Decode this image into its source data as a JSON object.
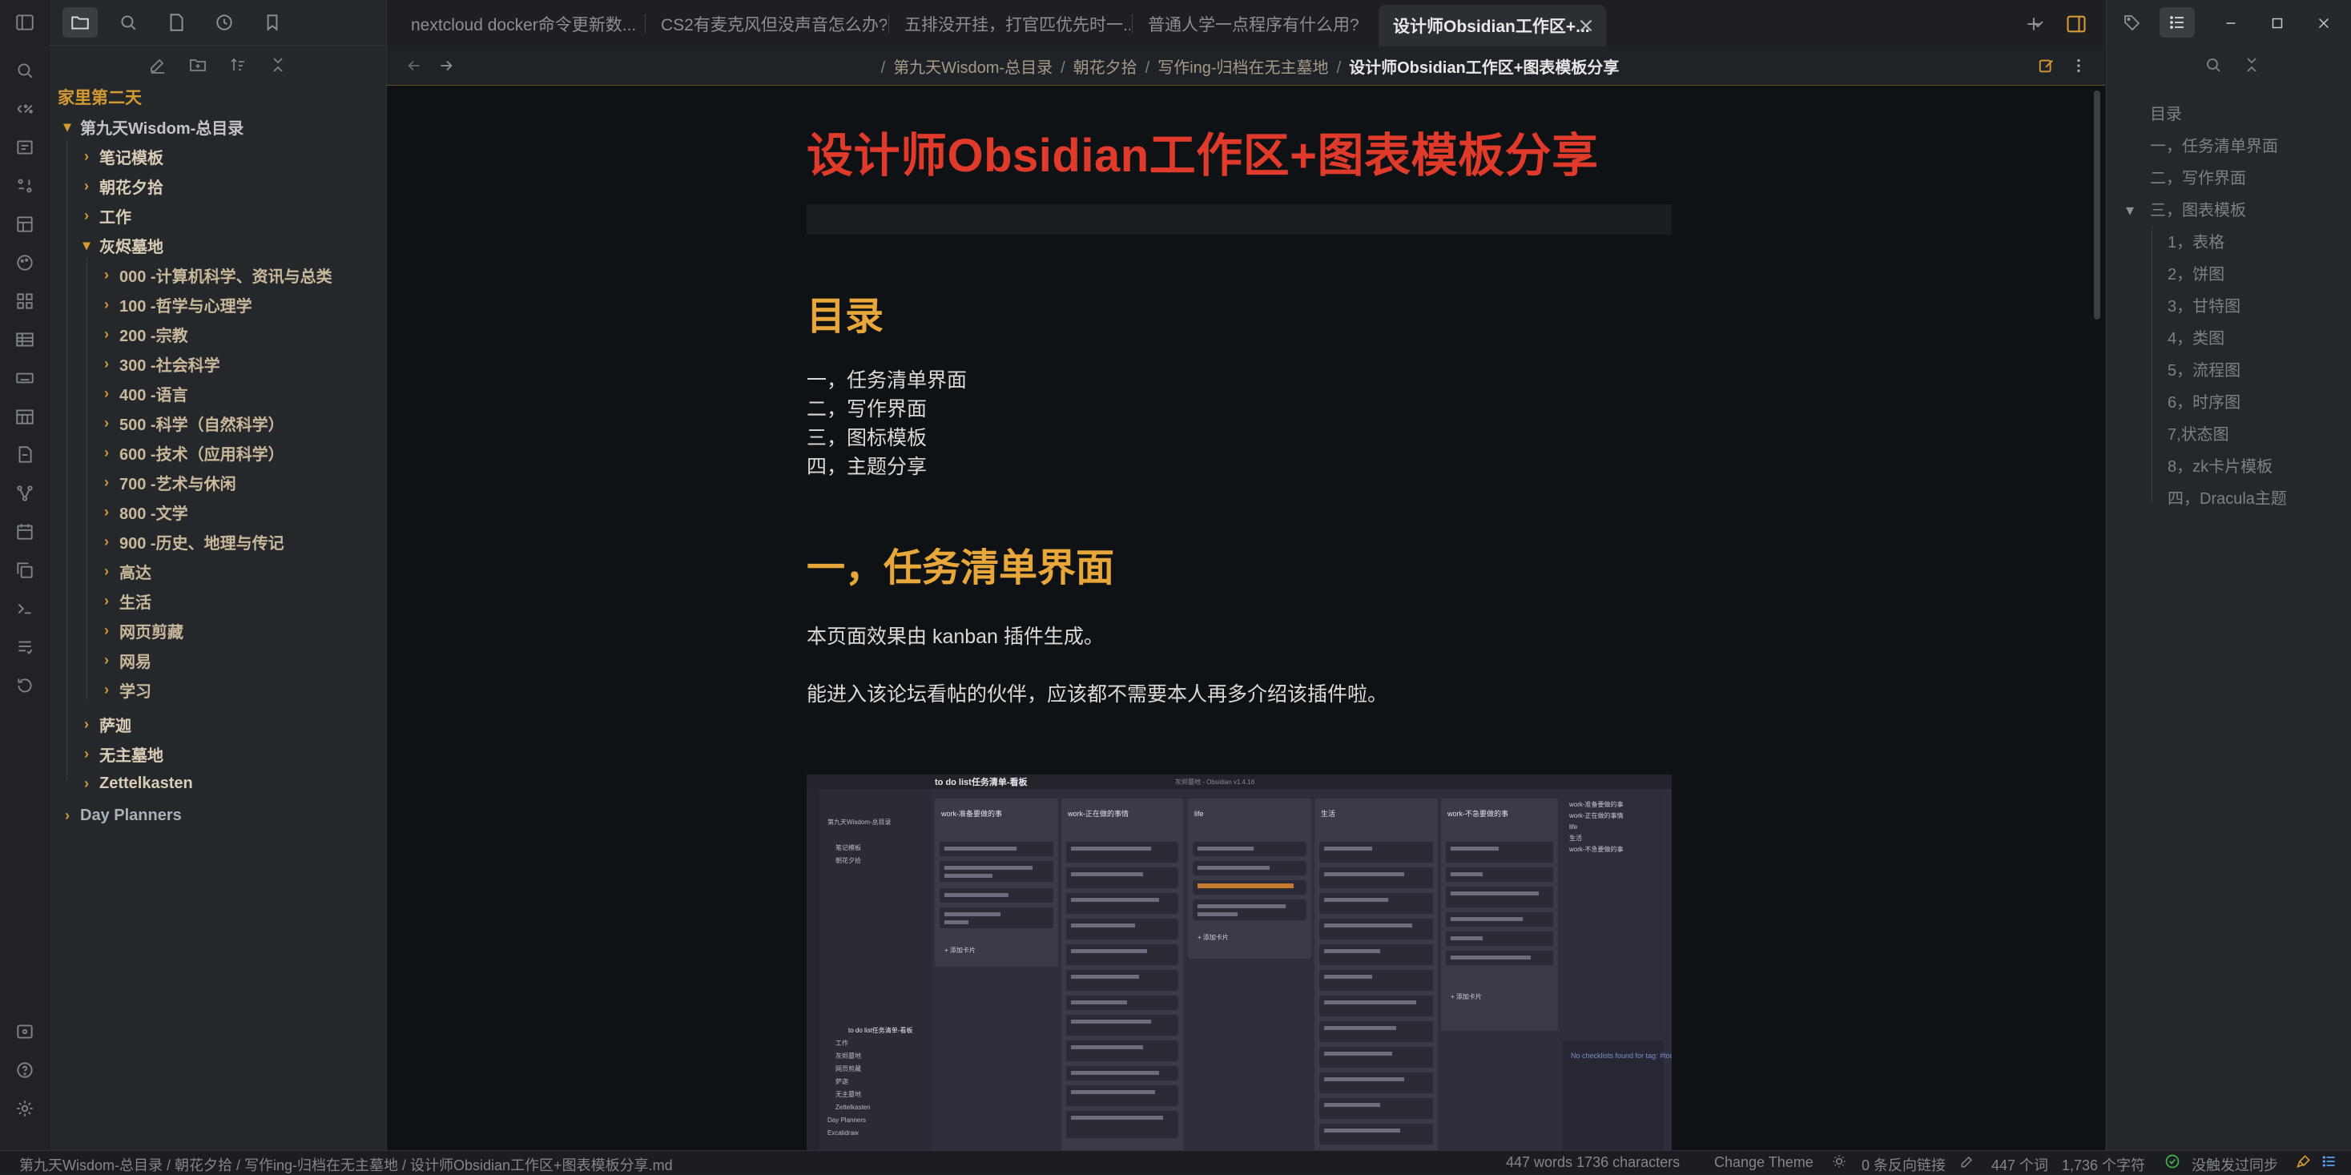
{
  "sidebar": {
    "vault_name": "家里第二天",
    "tree": [
      {
        "label": "第九天Wisdom-总目录",
        "arrow": "▾"
      },
      {
        "label": "笔记模板",
        "arrow": "›"
      },
      {
        "label": "朝花夕拾",
        "arrow": "›"
      },
      {
        "label": "工作",
        "arrow": "›"
      },
      {
        "label": "灰烬墓地",
        "arrow": "▾"
      },
      {
        "label": "000 -计算机科学、资讯与总类",
        "arrow": "›"
      },
      {
        "label": "100 -哲学与心理学",
        "arrow": "›"
      },
      {
        "label": "200 -宗教",
        "arrow": "›"
      },
      {
        "label": "300 -社会科学",
        "arrow": "›"
      },
      {
        "label": "400 -语言",
        "arrow": "›"
      },
      {
        "label": "500 -科学（自然科学）",
        "arrow": "›"
      },
      {
        "label": "600 -技术（应用科学）",
        "arrow": "›"
      },
      {
        "label": "700 -艺术与休闲",
        "arrow": "›"
      },
      {
        "label": "800 -文学",
        "arrow": "›"
      },
      {
        "label": "900 -历史、地理与传记",
        "arrow": "›"
      },
      {
        "label": "高达",
        "arrow": "›"
      },
      {
        "label": "生活",
        "arrow": "›"
      },
      {
        "label": "网页剪藏",
        "arrow": "›"
      },
      {
        "label": "网易",
        "arrow": "›"
      },
      {
        "label": "学习",
        "arrow": "›"
      },
      {
        "label": "萨迦",
        "arrow": "›"
      },
      {
        "label": "无主墓地",
        "arrow": "›"
      },
      {
        "label": "Zettelkasten",
        "arrow": "›"
      },
      {
        "label": "Day Planners",
        "arrow": "›"
      }
    ]
  },
  "tabs": [
    {
      "label": "nextcloud docker命令更新数..."
    },
    {
      "label": "CS2有麦克风但没声音怎么办?"
    },
    {
      "label": "五排没开挂，打官匹优先时一..."
    },
    {
      "label": "普通人学一点程序有什么用?"
    },
    {
      "label": "设计师Obsidian工作区+..."
    }
  ],
  "breadcrumb": {
    "parts": [
      "第九天Wisdom-总目录",
      "朝花夕拾",
      "写作ing-归档在无主墓地"
    ],
    "current": "设计师Obsidian工作区+图表模板分享",
    "separator": "/"
  },
  "document": {
    "title": "设计师Obsidian工作区+图表模板分享",
    "toc_heading": "目录",
    "toc_items": [
      "一，任务清单界面",
      "二，写作界面",
      "三，图标模板",
      "四，主题分享"
    ],
    "section1_heading": "一，任务清单界面",
    "para1": "本页面效果由 kanban 插件生成。",
    "para2": "能进入该论坛看帖的伙伴，应该都不需要本人再多介绍该插件啦。"
  },
  "screenshot": {
    "window_title": "to do list任务清单-看板",
    "app_title": "灰烬墓地 - Obsidian v1.4.16",
    "columns": [
      "work-准备要做的事",
      "work-正在做的事情",
      "life",
      "生活",
      "work-不急要做的事"
    ],
    "add_card": "+ 添加卡片",
    "tree": [
      "第九天Wisdom-总目录",
      "笔记模板",
      "朝花夕拾",
      "to do list任务清单-看板",
      "工作",
      "灰烬墓地",
      "网页剪藏",
      "萨迦",
      "无主墓地",
      "Zettelkasten",
      "Day Planners",
      "Excalidraw"
    ],
    "right_list": [
      "work-准备要做的事",
      "work-正在做的事情",
      "life",
      "生活",
      "work-不急要做的事"
    ],
    "no_checklist": "No checklists found for tag: #todo"
  },
  "outline": {
    "items": [
      {
        "label": "目录",
        "level": 0
      },
      {
        "label": "一，任务清单界面",
        "level": 0
      },
      {
        "label": "二，写作界面",
        "level": 0
      },
      {
        "label": "三，图表模板",
        "level": 0,
        "expanded": true
      },
      {
        "label": "1，表格",
        "level": 1
      },
      {
        "label": "2，饼图",
        "level": 1
      },
      {
        "label": "3，甘特图",
        "level": 1
      },
      {
        "label": "4，类图",
        "level": 1
      },
      {
        "label": "5，流程图",
        "level": 1
      },
      {
        "label": "6，时序图",
        "level": 1
      },
      {
        "label": "7,状态图",
        "level": 1
      },
      {
        "label": "8，zk卡片模板",
        "level": 1
      },
      {
        "label": "四，Dracula主题",
        "level": 1
      }
    ]
  },
  "status": {
    "path": "第九天Wisdom-总目录 / 朝花夕拾 / 写作ing-归档在无主墓地 / 设计师Obsidian工作区+图表模板分享.md",
    "word_count": "447 words 1736 characters",
    "change_theme": "Change Theme",
    "backlinks": "0 条反向链接",
    "words_cn": "447 个词",
    "chars_cn": "1,736 个字符",
    "sync": "没触发过同步"
  },
  "colors": {
    "accent": "#d59a32",
    "title_red": "#e03b2a",
    "heading_orange": "#e8a73a",
    "editor_bg": "#0f1214"
  }
}
